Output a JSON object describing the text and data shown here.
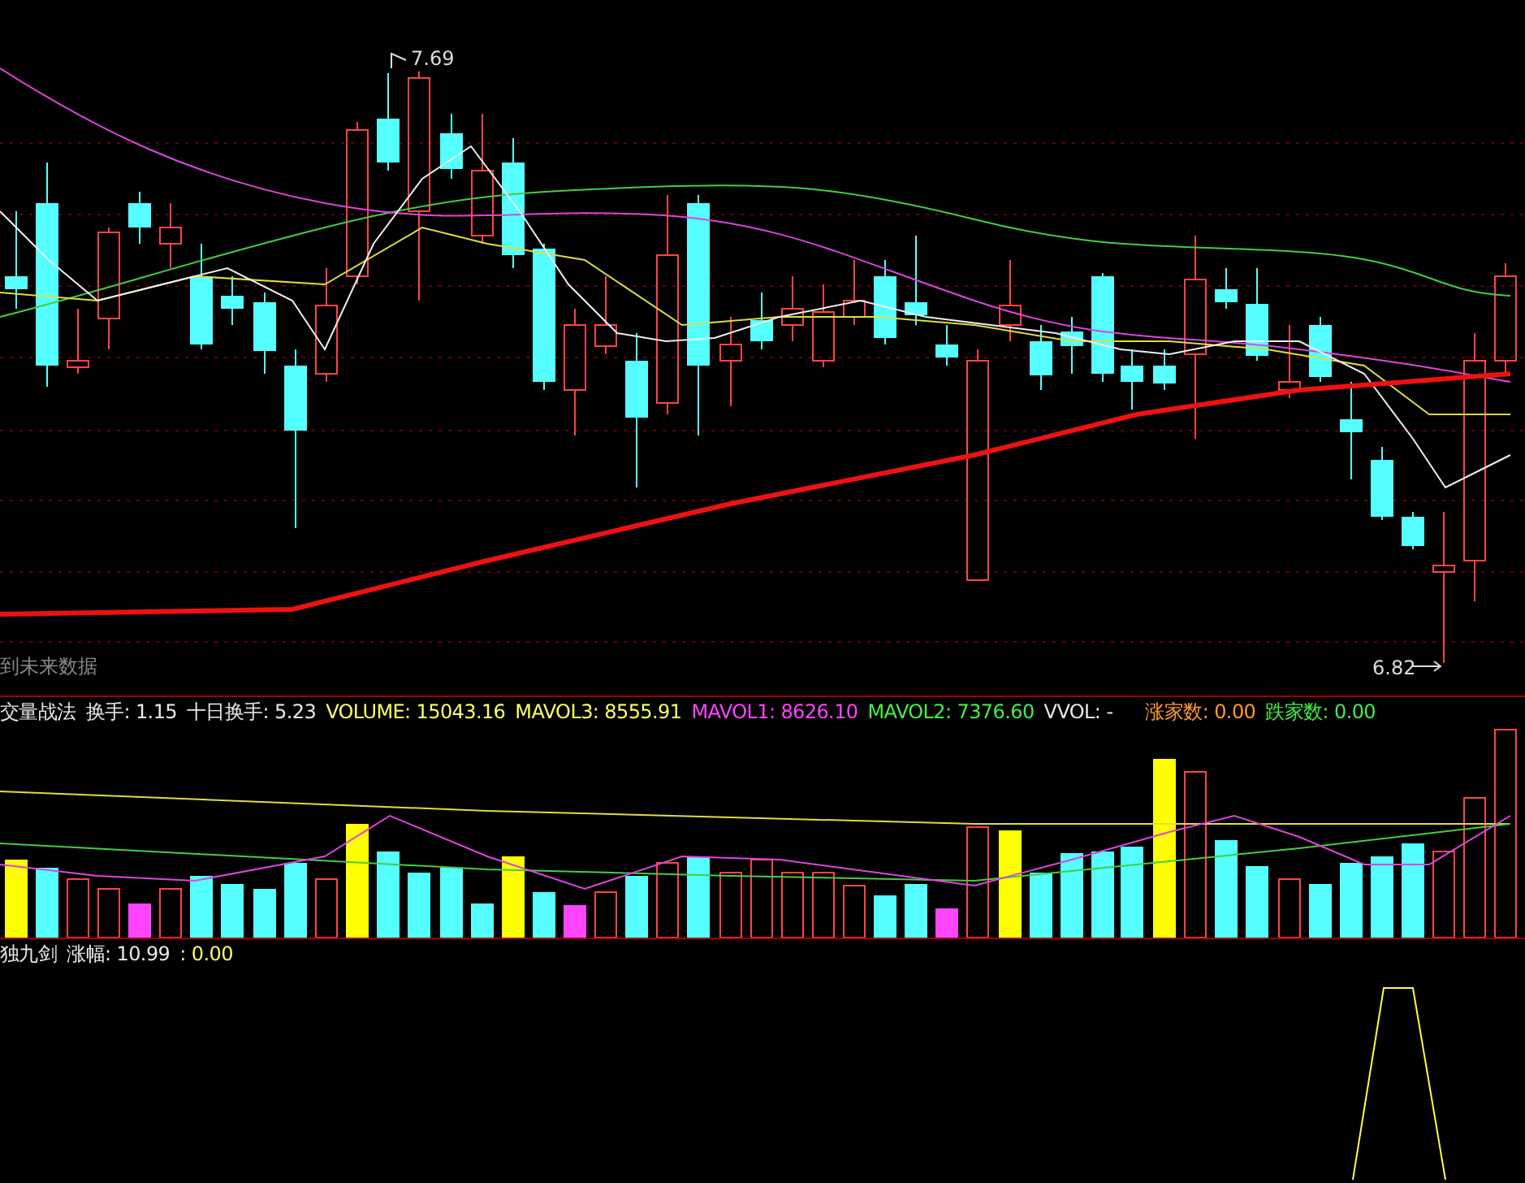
{
  "price_panel": {
    "note": "到未来数据",
    "high_label": "7.69",
    "low_label": "6.82"
  },
  "volume_panel": {
    "indicators": [
      {
        "text": "交量战法",
        "color": "#e8e8e8"
      },
      {
        "text": "换手: 1.15",
        "color": "#e8e8e8"
      },
      {
        "text": "十日换手: 5.23",
        "color": "#e8e8e8"
      },
      {
        "text": "VOLUME: 15043.16",
        "color": "#ffff66"
      },
      {
        "text": "MAVOL3: 8555.91",
        "color": "#ffff66"
      },
      {
        "text": "MAVOL1: 8626.10",
        "color": "#ff44ff"
      },
      {
        "text": "MAVOL2: 7376.60",
        "color": "#44ee44"
      },
      {
        "text": "VVOL: -",
        "color": "#e8e8e8"
      },
      {
        "text": "涨家数: 0.00",
        "color": "#ff9933"
      },
      {
        "text": "跌家数: 0.00",
        "color": "#44ee44"
      }
    ]
  },
  "signal_panel": {
    "indicators": [
      {
        "text": "独九剑",
        "color": "#e8e8e8"
      },
      {
        "text": "涨幅: 10.99",
        "color": "#e8e8e8"
      },
      {
        "text": ": 0.00",
        "color": "#ffff66"
      }
    ]
  }
}
